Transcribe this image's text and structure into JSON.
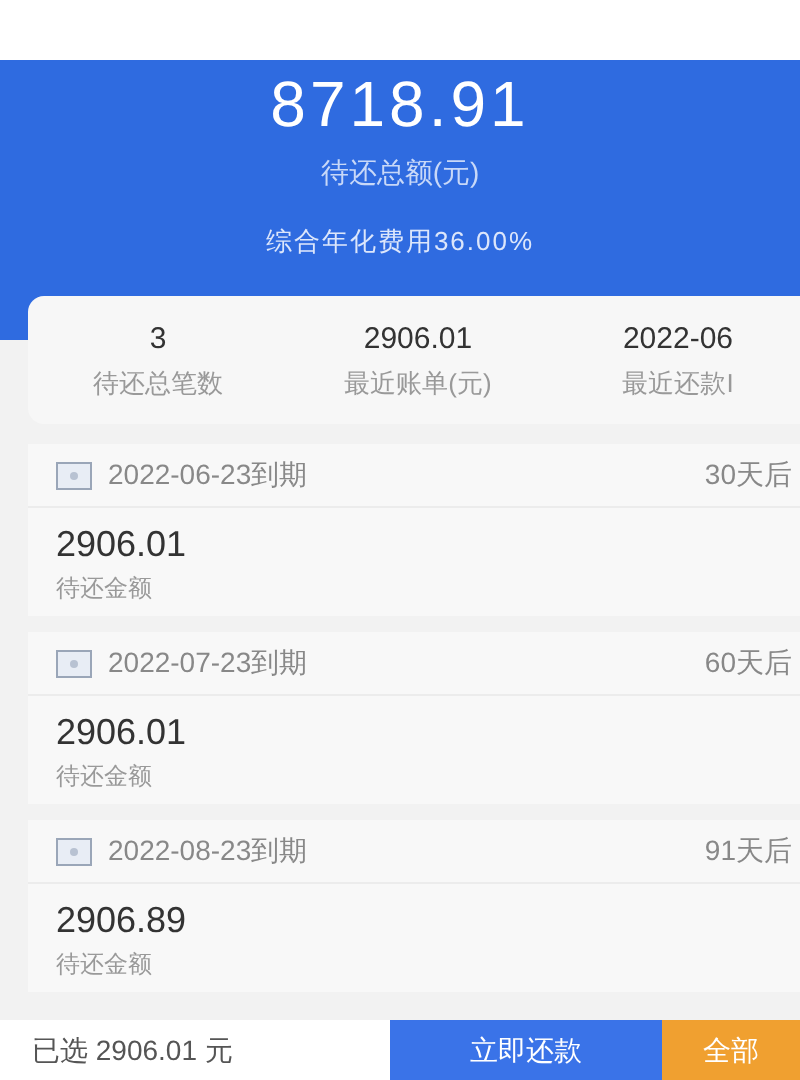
{
  "summary": {
    "total": "8718.91",
    "total_label": "待还总额(元)",
    "rate": "综合年化费用36.00%"
  },
  "stats": [
    {
      "value": "3",
      "label": "待还总笔数"
    },
    {
      "value": "2906.01",
      "label": "最近账单(元)"
    },
    {
      "value": "2022-06",
      "label": "最近还款I"
    }
  ],
  "bills": [
    {
      "due": "2022-06-23到期",
      "days": "30天后",
      "amount": "2906.01",
      "amount_label": "待还金额"
    },
    {
      "due": "2022-07-23到期",
      "days": "60天后",
      "amount": "2906.01",
      "amount_label": "待还金额"
    },
    {
      "due": "2022-08-23到期",
      "days": "91天后",
      "amount": "2906.89",
      "amount_label": "待还金额"
    }
  ],
  "footer": {
    "selected": "已选 2906.01 元",
    "pay_button": "立即还款",
    "all_button": "全部"
  }
}
